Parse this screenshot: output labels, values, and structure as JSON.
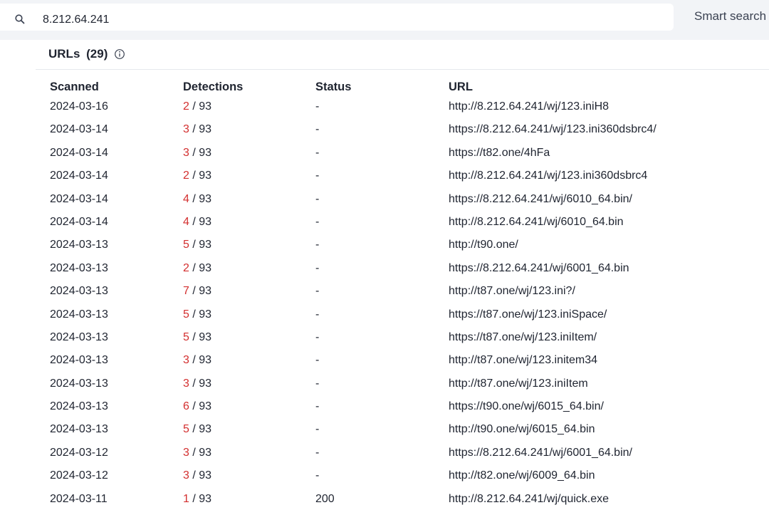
{
  "search": {
    "value": "8.212.64.241",
    "smart_search_label": "Smart search"
  },
  "section": {
    "title": "URLs",
    "count": "(29)"
  },
  "table": {
    "headers": {
      "scanned": "Scanned",
      "detections": "Detections",
      "status": "Status",
      "url": "URL"
    },
    "rows": [
      {
        "scanned": "2024-03-16",
        "detections": "2",
        "total": " / 93",
        "status": "-",
        "url": "http://8.212.64.241/wj/123.iniH8"
      },
      {
        "scanned": "2024-03-14",
        "detections": "3",
        "total": " / 93",
        "status": "-",
        "url": "https://8.212.64.241/wj/123.ini360dsbrc4/"
      },
      {
        "scanned": "2024-03-14",
        "detections": "3",
        "total": " / 93",
        "status": "-",
        "url": "https://t82.one/4hFa"
      },
      {
        "scanned": "2024-03-14",
        "detections": "2",
        "total": " / 93",
        "status": "-",
        "url": "http://8.212.64.241/wj/123.ini360dsbrc4"
      },
      {
        "scanned": "2024-03-14",
        "detections": "4",
        "total": " / 93",
        "status": "-",
        "url": "https://8.212.64.241/wj/6010_64.bin/"
      },
      {
        "scanned": "2024-03-14",
        "detections": "4",
        "total": " / 93",
        "status": "-",
        "url": "http://8.212.64.241/wj/6010_64.bin"
      },
      {
        "scanned": "2024-03-13",
        "detections": "5",
        "total": " / 93",
        "status": "-",
        "url": "http://t90.one/"
      },
      {
        "scanned": "2024-03-13",
        "detections": "2",
        "total": " / 93",
        "status": "-",
        "url": "https://8.212.64.241/wj/6001_64.bin"
      },
      {
        "scanned": "2024-03-13",
        "detections": "7",
        "total": " / 93",
        "status": "-",
        "url": "http://t87.one/wj/123.ini?/"
      },
      {
        "scanned": "2024-03-13",
        "detections": "5",
        "total": " / 93",
        "status": "-",
        "url": "https://t87.one/wj/123.iniSpace/"
      },
      {
        "scanned": "2024-03-13",
        "detections": "5",
        "total": " / 93",
        "status": "-",
        "url": "https://t87.one/wj/123.iniItem/"
      },
      {
        "scanned": "2024-03-13",
        "detections": "3",
        "total": " / 93",
        "status": "-",
        "url": "http://t87.one/wj/123.initem34"
      },
      {
        "scanned": "2024-03-13",
        "detections": "3",
        "total": " / 93",
        "status": "-",
        "url": "http://t87.one/wj/123.iniItem"
      },
      {
        "scanned": "2024-03-13",
        "detections": "6",
        "total": " / 93",
        "status": "-",
        "url": "https://t90.one/wj/6015_64.bin/"
      },
      {
        "scanned": "2024-03-13",
        "detections": "5",
        "total": " / 93",
        "status": "-",
        "url": "http://t90.one/wj/6015_64.bin"
      },
      {
        "scanned": "2024-03-12",
        "detections": "3",
        "total": " / 93",
        "status": "-",
        "url": "https://8.212.64.241/wj/6001_64.bin/"
      },
      {
        "scanned": "2024-03-12",
        "detections": "3",
        "total": " / 93",
        "status": "-",
        "url": "http://t82.one/wj/6009_64.bin"
      },
      {
        "scanned": "2024-03-11",
        "detections": "1",
        "total": " / 93",
        "status": "200",
        "url": "http://8.212.64.241/wj/quick.exe"
      }
    ]
  },
  "colors": {
    "detection": "#d32f2f",
    "topbar": "#f2f4f7"
  },
  "icons": {
    "search": "search-icon",
    "info": "info-icon"
  }
}
